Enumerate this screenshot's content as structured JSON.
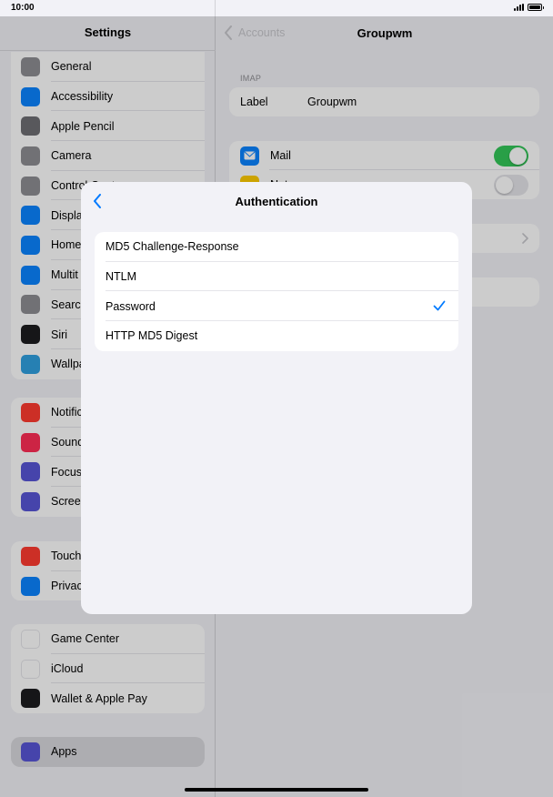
{
  "status_bar": {
    "time": "10:00"
  },
  "sidebar": {
    "title": "Settings",
    "groups": [
      {
        "items": [
          {
            "label": "General",
            "icon": "gear-icon",
            "color": "#8e8e93"
          },
          {
            "label": "Accessibility",
            "icon": "accessibility-icon",
            "color": "#0a84ff"
          },
          {
            "label": "Apple Pencil",
            "icon": "pencil-icon",
            "color": "#6e6e73"
          },
          {
            "label": "Camera",
            "icon": "camera-icon",
            "color": "#8e8e93"
          },
          {
            "label": "Control Centre",
            "icon": "toggles-icon",
            "color": "#8e8e93"
          },
          {
            "label": "Displa",
            "icon": "brightness-icon",
            "color": "#0a84ff"
          },
          {
            "label": "Home",
            "icon": "home-screen-icon",
            "color": "#0a84ff"
          },
          {
            "label": "Multit",
            "icon": "multitasking-icon",
            "color": "#0a84ff"
          },
          {
            "label": "Searc",
            "icon": "search-icon",
            "color": "#8e8e93"
          },
          {
            "label": "Siri",
            "icon": "siri-icon",
            "color": "#1c1c1e"
          },
          {
            "label": "Wallpa",
            "icon": "wallpaper-icon",
            "color": "#30a0e0"
          }
        ]
      },
      {
        "items": [
          {
            "label": "Notific",
            "icon": "bell-icon",
            "color": "#ff3b30"
          },
          {
            "label": "Sound",
            "icon": "speaker-icon",
            "color": "#ff2d55"
          },
          {
            "label": "Focus",
            "icon": "moon-icon",
            "color": "#5856d6"
          },
          {
            "label": "Scree",
            "icon": "hourglass-icon",
            "color": "#5856d6"
          }
        ]
      },
      {
        "items": [
          {
            "label": "Touch",
            "icon": "lock-icon",
            "color": "#ff3b30"
          },
          {
            "label": "Privac",
            "icon": "hand-icon",
            "color": "#0a84ff"
          }
        ]
      },
      {
        "items": [
          {
            "label": "Game Center",
            "icon": "game-center-icon",
            "color": "#ffffff"
          },
          {
            "label": "iCloud",
            "icon": "cloud-icon",
            "color": "#ffffff"
          },
          {
            "label": "Wallet & Apple Pay",
            "icon": "wallet-icon",
            "color": "#1c1c1e"
          }
        ]
      },
      {
        "items": [
          {
            "label": "Apps",
            "icon": "apps-grid-icon",
            "color": "#5856d6",
            "selected": true
          }
        ]
      }
    ]
  },
  "detail": {
    "back_label": "Accounts",
    "title": "Groupwm",
    "section_header": "IMAP",
    "label_row": {
      "label": "Label",
      "value": "Groupwm"
    },
    "services": [
      {
        "label": "Mail",
        "icon": "mail-icon",
        "color": "#0a84ff",
        "enabled": true
      },
      {
        "label": "Not",
        "icon": "notes-icon",
        "color": "#ffcc00",
        "enabled": false
      }
    ]
  },
  "modal": {
    "title": "Authentication",
    "options": [
      {
        "label": "MD5 Challenge-Response",
        "selected": false
      },
      {
        "label": "NTLM",
        "selected": false
      },
      {
        "label": "Password",
        "selected": true
      },
      {
        "label": "HTTP MD5 Digest",
        "selected": false
      }
    ]
  },
  "colors": {
    "accent": "#007aff",
    "toggle_on": "#34c759"
  }
}
